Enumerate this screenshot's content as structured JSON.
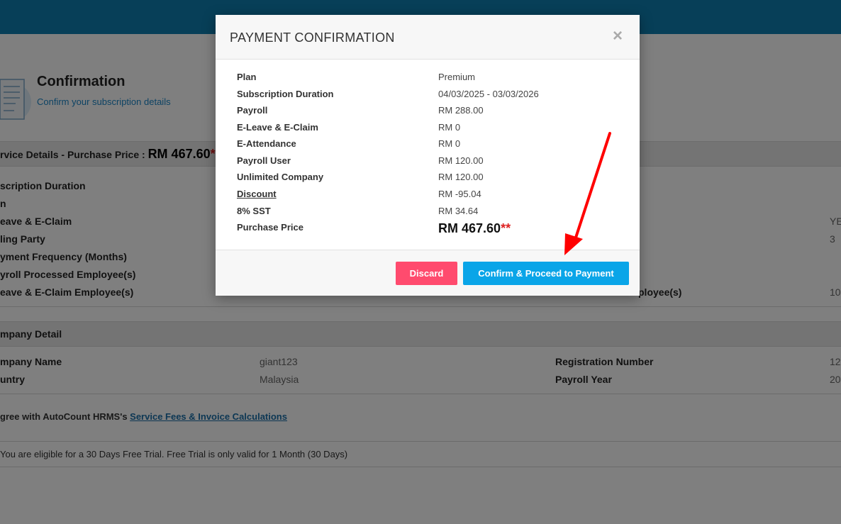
{
  "page": {
    "title": "Confirmation",
    "subtitle": "Confirm your subscription details",
    "service_bar": {
      "label": "rvice Details - Purchase Price : ",
      "price": "RM 467.60",
      "star": "*"
    },
    "service_rows": [
      {
        "label": "scription Duration"
      },
      {
        "label": "n"
      },
      {
        "label": "eave & E-Claim"
      },
      {
        "label": "ling Party"
      },
      {
        "label": "yment Frequency (Months)"
      },
      {
        "label": "yroll Processed Employee(s)"
      },
      {
        "label": "eave & E-Claim Employee(s)"
      }
    ],
    "service_right": {
      "row3_val": "YE",
      "row4_val": "3",
      "row7_label": "ployee(s)",
      "row7_val": "10"
    },
    "company_bar": "mpany Detail",
    "company": {
      "name_label": "mpany Name",
      "name_value": "giant123",
      "reg_label": "Registration Number",
      "reg_value": "12",
      "country_label": "untry",
      "country_value": "Malaysia",
      "payroll_year_label": "Payroll Year",
      "payroll_year_value": "20"
    },
    "agree_text": "gree with AutoCount HRMS's ",
    "agree_link": "Service Fees & Invoice Calculations",
    "trial_text": " You are eligible for a 30 Days Free Trial. Free Trial is only valid for 1 Month (30 Days)"
  },
  "modal": {
    "title": "PAYMENT CONFIRMATION",
    "close": "×",
    "rows": [
      {
        "label": "Plan",
        "value": "Premium"
      },
      {
        "label": "Subscription Duration",
        "value": "04/03/2025 - 03/03/2026"
      },
      {
        "label": "Payroll",
        "value": "RM 288.00"
      },
      {
        "label": "E-Leave & E-Claim",
        "value": "RM 0"
      },
      {
        "label": "E-Attendance",
        "value": "RM 0"
      },
      {
        "label": "Payroll User",
        "value": "RM 120.00"
      },
      {
        "label": "Unlimited Company",
        "value": "RM 120.00"
      },
      {
        "label": "Discount",
        "value": "RM -95.04"
      },
      {
        "label": "8% SST",
        "value": "RM 34.64"
      }
    ],
    "purchase_label": "Purchase Price",
    "purchase_value": "RM 467.60",
    "purchase_star": "**",
    "discard_label": "Discard",
    "confirm_label": "Confirm & Proceed to Payment"
  },
  "colors": {
    "topbar": "#0f7fb0",
    "discard": "#ff4b6e",
    "confirm": "#0aa5e8",
    "arrow": "#ff0000"
  },
  "icons": {
    "page_icon": "document-icon",
    "close": "close-icon",
    "annotation": "red-arrow-icon"
  }
}
